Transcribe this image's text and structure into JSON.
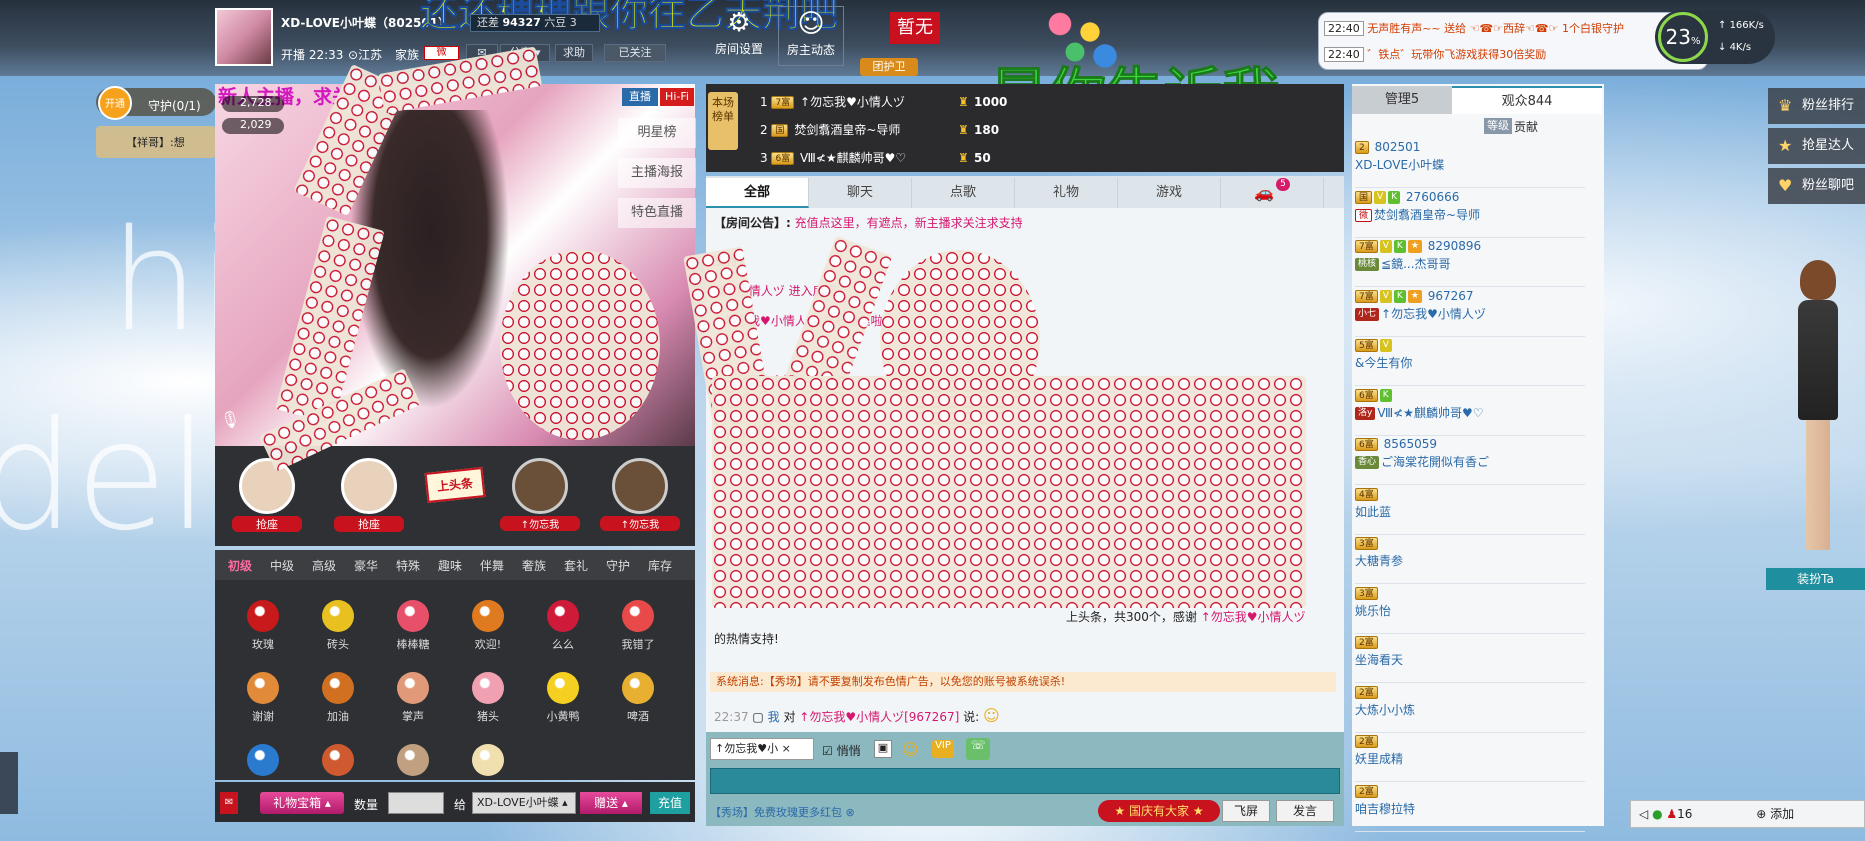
{
  "header": {
    "anchor_name": "XD-LOVE小叶蝶（802501）",
    "start_time": "开播 22:33",
    "location": "江苏",
    "family_label": "家族",
    "family_badge": "微",
    "share_label": "分享",
    "help_label": "求助",
    "follow_label": "已关注",
    "overlay_banner": "还还稠稠跟你往乙天荆吧",
    "coins_prefix": "还差",
    "coins_value": "94327",
    "coins_suffix": "六豆 3",
    "room_settings_label": "房间设置",
    "host_news_label": "房主动态",
    "zanwu_label": "暂无",
    "group_guard_label": "团护卫",
    "big_green_text": "是你告诉我"
  },
  "notifications": [
    {
      "time": "22:40",
      "text": "无声胜有声~~ 送给 ☜☎☞西辞☜☎☞ 1个白银守护"
    },
    {
      "time": "22:40",
      "text": "゛铁点゛玩带你飞游戏获得30倍奖励"
    }
  ],
  "netspeed": {
    "percent": "23",
    "pct_sign": "%",
    "up": "166K/s",
    "down": "4K/s"
  },
  "guard": {
    "open_label": "开通",
    "guard_label": "守护(0/1)",
    "guard_user": "【祥哥】:想"
  },
  "stream": {
    "title_marquee": "新人主播，求关注，求升",
    "tag_live": "直播",
    "tag_hifi": "Hi-Fi",
    "viewers": "2,728",
    "likes": "2,029",
    "side_links": [
      "明星榜",
      "主播海报",
      "特色直播"
    ]
  },
  "seats": [
    {
      "label": "抢座"
    },
    {
      "label": "抢座"
    },
    {
      "label": "上头条"
    },
    {
      "label": "↑勿忘我"
    },
    {
      "label": "↑勿忘我"
    }
  ],
  "gift_tabs": [
    "初级",
    "中级",
    "高级",
    "豪华",
    "特殊",
    "趣味",
    "伴舞",
    "奢族",
    "套礼",
    "守护",
    "库存"
  ],
  "gifts": [
    {
      "name": "玫瑰",
      "color": "#c81a1a"
    },
    {
      "name": "砖头",
      "color": "#e8c020"
    },
    {
      "name": "棒棒糖",
      "color": "#e8506a"
    },
    {
      "name": "欢迎!",
      "color": "#e07a20"
    },
    {
      "name": "么么",
      "color": "#d01a3a"
    },
    {
      "name": "我错了",
      "color": "#e84a4a"
    },
    {
      "name": "谢谢",
      "color": "#e08a3a"
    },
    {
      "name": "加油",
      "color": "#d07020"
    },
    {
      "name": "掌声",
      "color": "#e09a7a"
    },
    {
      "name": "猪头",
      "color": "#f0a0b0"
    },
    {
      "name": "小黄鸭",
      "color": "#f5d020"
    },
    {
      "name": "啤酒",
      "color": "#e8b030"
    },
    {
      "name": "",
      "color": "#2a7ad0"
    },
    {
      "name": "",
      "color": "#d05a30"
    },
    {
      "name": "",
      "color": "#c0a080"
    },
    {
      "name": "",
      "color": "#f0e0b0"
    }
  ],
  "gift_bar": {
    "treasure_label": "礼物宝箱",
    "qty_label": "数量",
    "to_label": "给",
    "recipient": "XD-LOVE小叶蝶",
    "send_label": "赠送",
    "recharge_label": "充值"
  },
  "ranking": {
    "label": "本场榜单",
    "rows": [
      {
        "rank": "1",
        "badge": "7富",
        "name": "↑勿忘我♥小情人ヅ",
        "score": "1000"
      },
      {
        "rank": "2",
        "badge": "国",
        "name": "焚剑翥酒皇帝~导师",
        "score": "180"
      },
      {
        "rank": "3",
        "badge": "6富",
        "name": "Ⅷ≮★麒麟帅哥♥♡",
        "score": "50"
      }
    ]
  },
  "chat_tabs": [
    {
      "label": "全部"
    },
    {
      "label": "聊天"
    },
    {
      "label": "点歌"
    },
    {
      "label": "礼物"
    },
    {
      "label": "游戏"
    },
    {
      "label": "",
      "badge": "5"
    }
  ],
  "chat": {
    "notice_label": "【房间公告】:",
    "notice_text": "充值点这里，有遮点，新主播求关注求支持",
    "lines": [
      "支持!",
      "我♥小情人ヅ 进入房间",
      "↑勿忘我♥小情人ヅ 是冠粉丝啦!",
      "↑勿忘我",
      "↑勿忘我♥小情人ヅ"
    ],
    "gift_summary_a": "上头条，共300个，感谢",
    "gift_summary_user": "↑勿忘我♥小情人ヅ",
    "gift_summary_b": "的热情支持!",
    "system_msg": "系统消息:【秀场】请不要复制发布色情广告，以免您的账号被系统误杀!",
    "my_time": "22:37",
    "my_line_a": "我",
    "my_line_b": "对",
    "my_line_user": "↑勿忘我♥小情人ヅ[967267]",
    "my_line_c": "说:"
  },
  "chat_input": {
    "target": "↑勿忘我♥小",
    "private_label": "悄悄",
    "ad_text": "【秀场】免费玫瑰更多红包",
    "festival_label": "国庆有大家",
    "fly_label": "飞屏",
    "send_label": "发言"
  },
  "userlist": {
    "tab_admin": "管理5",
    "tab_audience": "观众844",
    "sub_level": "等级",
    "sub_contrib": "贡献",
    "users": [
      {
        "badges": [
          "2"
        ],
        "id": "802501",
        "name": "XD-LOVE小叶蝶"
      },
      {
        "badges": [
          "国",
          "V",
          "K"
        ],
        "id": "2760666",
        "fam": "微",
        "name": "焚剑翥酒皇帝~导师"
      },
      {
        "badges": [
          "7富",
          "V",
          "K",
          "★"
        ],
        "id": "8290896",
        "fam": "桃核",
        "name": "≦鏡...杰哥哥"
      },
      {
        "badges": [
          "7富",
          "V",
          "K",
          "★"
        ],
        "id": "967267",
        "fam": "小七",
        "name": "↑勿忘我♥小情人ヅ"
      },
      {
        "badges": [
          "5富",
          "V"
        ],
        "id": "",
        "name": "&今生有你"
      },
      {
        "badges": [
          "6富",
          "K"
        ],
        "id": "",
        "fam": "洛y",
        "name": "Ⅷ≮★麒麟帅哥♥♡"
      },
      {
        "badges": [
          "6富"
        ],
        "id": "8565059",
        "fam": "香心",
        "name": "ご海棠花開似有香ご"
      },
      {
        "badges": [
          "4富"
        ],
        "id": "",
        "name": "如此蓝"
      },
      {
        "badges": [
          "3富"
        ],
        "id": "",
        "name": "大糖青参"
      },
      {
        "badges": [
          "3富"
        ],
        "id": "",
        "name": "姚乐怡"
      },
      {
        "badges": [
          "2富"
        ],
        "id": "",
        "name": "坐海看天"
      },
      {
        "badges": [
          "2富"
        ],
        "id": "",
        "name": "大炼小小炼"
      },
      {
        "badges": [
          "2富"
        ],
        "id": "",
        "name": "妖里成精"
      },
      {
        "badges": [
          "2富"
        ],
        "id": "",
        "name": "咱吉穆拉特"
      }
    ]
  },
  "sidebar": {
    "items": [
      {
        "label": "粉丝排行",
        "icon": "crown-icon"
      },
      {
        "label": "抢星达人",
        "icon": "star-icon"
      },
      {
        "label": "粉丝聊吧",
        "icon": "heart-icon"
      }
    ],
    "dress_label": "装扮Ta"
  },
  "footer": {
    "count": "16",
    "add_label": "添加"
  },
  "background_text": [
    "hic",
    "del"
  ]
}
